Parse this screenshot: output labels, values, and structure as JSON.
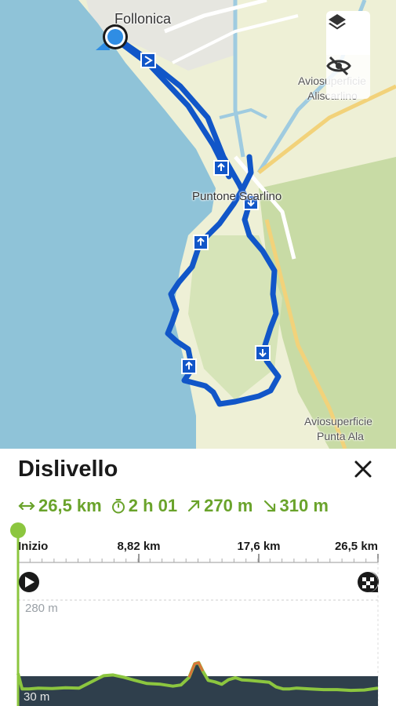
{
  "map": {
    "labels": {
      "town": "Follonica",
      "place": "Puntone Scarlino",
      "airfield1_line1": "Aviosuperficie",
      "airfield1_line2": "Aliscarlino",
      "airfield2_line1": "Aviosuperficie",
      "airfield2_line2": "Punta Ala"
    },
    "buttons": {
      "layers_icon": "layers-icon",
      "visibility_icon": "eye-off-icon"
    },
    "colors": {
      "sea": "#8fc3d8",
      "land": "#eef0d6",
      "forest": "#c8dba5",
      "route": "#1156c8",
      "location": "#2f8de4"
    }
  },
  "panel": {
    "title": "Dislivello",
    "close_icon": "close-icon",
    "stats": {
      "distance": "26,5 km",
      "duration": "2 h 01",
      "ascent": "270 m",
      "descent": "310 m"
    },
    "accent": "#6aa32b"
  },
  "chart_data": {
    "type": "area",
    "x_tick_labels": [
      "Inizio",
      "8,82 km",
      "17,6 km",
      "26,5 km"
    ],
    "y_labels": [
      "280 m",
      "30 m"
    ],
    "xlim": [
      0,
      26.5
    ],
    "ylim": [
      30,
      280
    ],
    "start_icon": "start-flag-icon",
    "finish_icon": "finish-flag-icon",
    "x": [
      0,
      0.3,
      0.8,
      1.5,
      2.5,
      3.5,
      4.5,
      5.5,
      6.3,
      7.0,
      7.8,
      8.6,
      9.5,
      10.5,
      11.4,
      12.0,
      12.6,
      13.0,
      13.3,
      13.6,
      14.0,
      14.5,
      15.0,
      15.5,
      16.0,
      16.5,
      17.0,
      17.6,
      18.5,
      19.0,
      19.5,
      20.0,
      20.5,
      21.5,
      22.5,
      23.5,
      24.5,
      25.5,
      26.5
    ],
    "y": [
      90,
      50,
      50,
      52,
      51,
      53,
      52,
      70,
      84,
      86,
      80,
      72,
      64,
      62,
      57,
      60,
      80,
      115,
      118,
      96,
      72,
      68,
      62,
      74,
      79,
      73,
      72,
      70,
      67,
      55,
      50,
      50,
      52,
      50,
      48,
      48,
      46,
      47,
      52
    ]
  }
}
